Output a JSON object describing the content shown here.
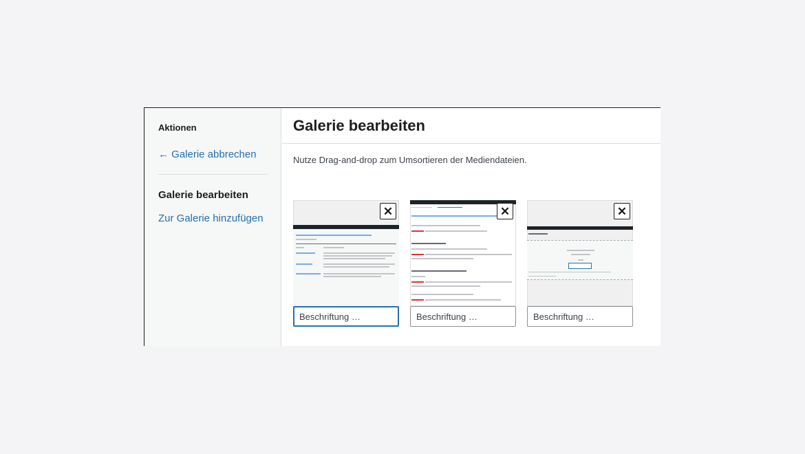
{
  "sidebar": {
    "heading": "Aktionen",
    "cancel_link": "← Galerie abbrechen",
    "current_item": "Galerie bearbeiten",
    "add_link": "Zur Galerie hinzufügen"
  },
  "main": {
    "title": "Galerie bearbeiten",
    "instructions": "Nutze Drag-and-drop zum Umsortieren der Mediendateien."
  },
  "attachments": [
    {
      "caption_placeholder": "Beschriftung …",
      "close_symbol": "✕"
    },
    {
      "caption_placeholder": "Beschriftung …",
      "close_symbol": "✕"
    },
    {
      "caption_placeholder": "Beschriftung …",
      "close_symbol": "✕"
    }
  ],
  "colors": {
    "link": "#2271b1",
    "text": "#1e1e1e",
    "border": "#dcdcde",
    "sidebar_bg": "#f6f7f7",
    "page_bg": "#f4f4f6"
  }
}
